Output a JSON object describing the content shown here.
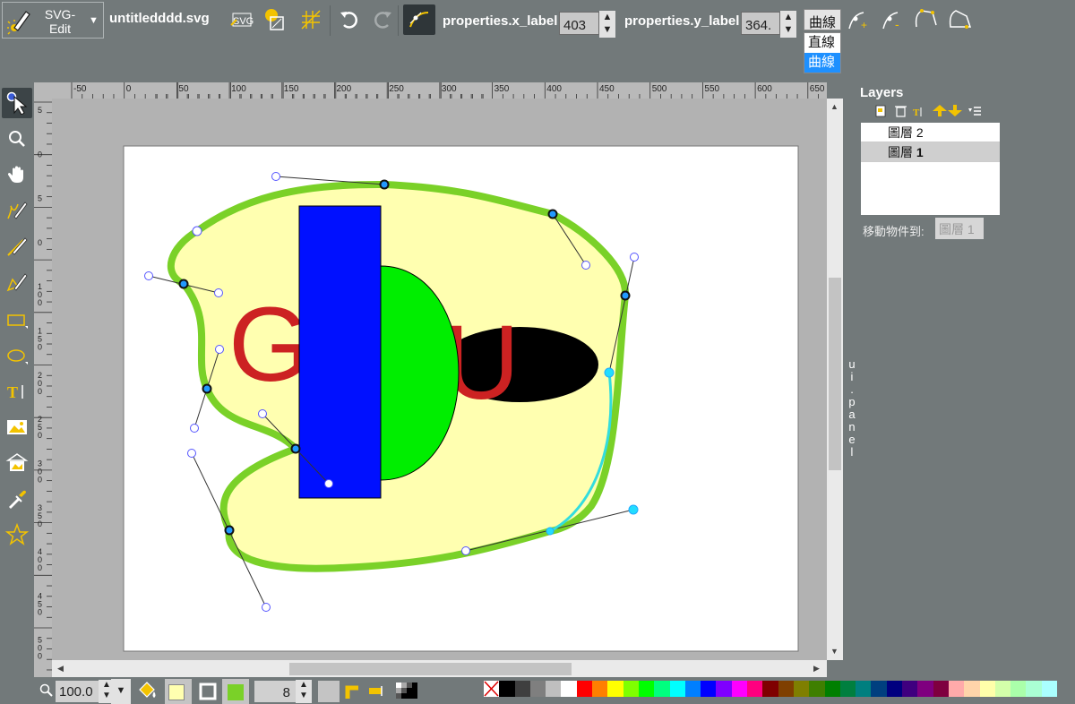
{
  "app": {
    "logo_label": "SVG-\nEdit",
    "doc_title": "untitledddd.svg"
  },
  "toolbar": {
    "x_label": "properties.x_label",
    "x_value": "403",
    "y_label": "properties.y_label",
    "y_value": "364.",
    "segment_type": "曲線",
    "segment_options": [
      "直線",
      "曲線"
    ],
    "icons": [
      "svg-import-icon",
      "image-import-icon",
      "grid-icon",
      "undo-icon",
      "redo-icon",
      "node-link-icon",
      "add-node-icon",
      "delete-node-icon",
      "open-path-icon",
      "close-path-icon"
    ]
  },
  "tools": [
    "select-tool-icon",
    "zoom-tool-icon",
    "pan-tool-icon",
    "pencil-tool-icon",
    "line-tool-icon",
    "path-tool-icon",
    "rect-tool-icon",
    "ellipse-tool-icon",
    "text-tool-icon",
    "image-tool-icon",
    "library-tool-icon",
    "eyedropper-tool-icon",
    "star-tool-icon"
  ],
  "ruler": {
    "top_labels": [
      "-50",
      "0",
      "50",
      "100",
      "150",
      "200",
      "250",
      "300",
      "350",
      "400",
      "450",
      "500",
      "550",
      "600",
      "650"
    ],
    "left_labels": [
      "5",
      "0",
      "5",
      "0",
      "1 0 0",
      "1 5 0",
      "2 0 0",
      "2 5 0",
      "3 0 0",
      "3 5 0",
      "4 0 0",
      "4 5 0",
      "5 0 0"
    ]
  },
  "canvas": {
    "text_left": "G",
    "text_right": "U",
    "colors": {
      "fill_blob": "#ffffb0",
      "stroke_blob": "#7ad128",
      "rect": "#0010ff",
      "green": "#00ee00",
      "ellipse": "#000000",
      "text": "#cc2222"
    }
  },
  "layers": {
    "title": "Layers",
    "items": [
      {
        "label": "圖層",
        "num": "2"
      },
      {
        "label": "圖層",
        "num": "1"
      }
    ],
    "current": 1,
    "move_label": "移動物件到:",
    "move_value": "圖層 1"
  },
  "ui_panel": "ui.panel",
  "bottom": {
    "zoom": "100.0",
    "stroke_width": "8",
    "fill_color": "#ffffb0",
    "stroke_color": "#7ad128"
  },
  "palette": [
    "#000000",
    "#3f3f3f",
    "#7f7f7f",
    "#bfbfbf",
    "#ffffff",
    "#ff0000",
    "#ff7f00",
    "#ffff00",
    "#7fff00",
    "#00ff00",
    "#00ff7f",
    "#00ffff",
    "#007fff",
    "#0000ff",
    "#7f00ff",
    "#ff00ff",
    "#ff007f",
    "#7f0000",
    "#7f3f00",
    "#7f7f00",
    "#3f7f00",
    "#007f00",
    "#007f3f",
    "#007f7f",
    "#003f7f",
    "#00007f",
    "#3f007f",
    "#7f007f",
    "#7f003f",
    "#ffaaaa",
    "#ffd4aa",
    "#ffffaa",
    "#d4ffaa",
    "#aaffaa",
    "#aaffd4",
    "#aaffff"
  ]
}
